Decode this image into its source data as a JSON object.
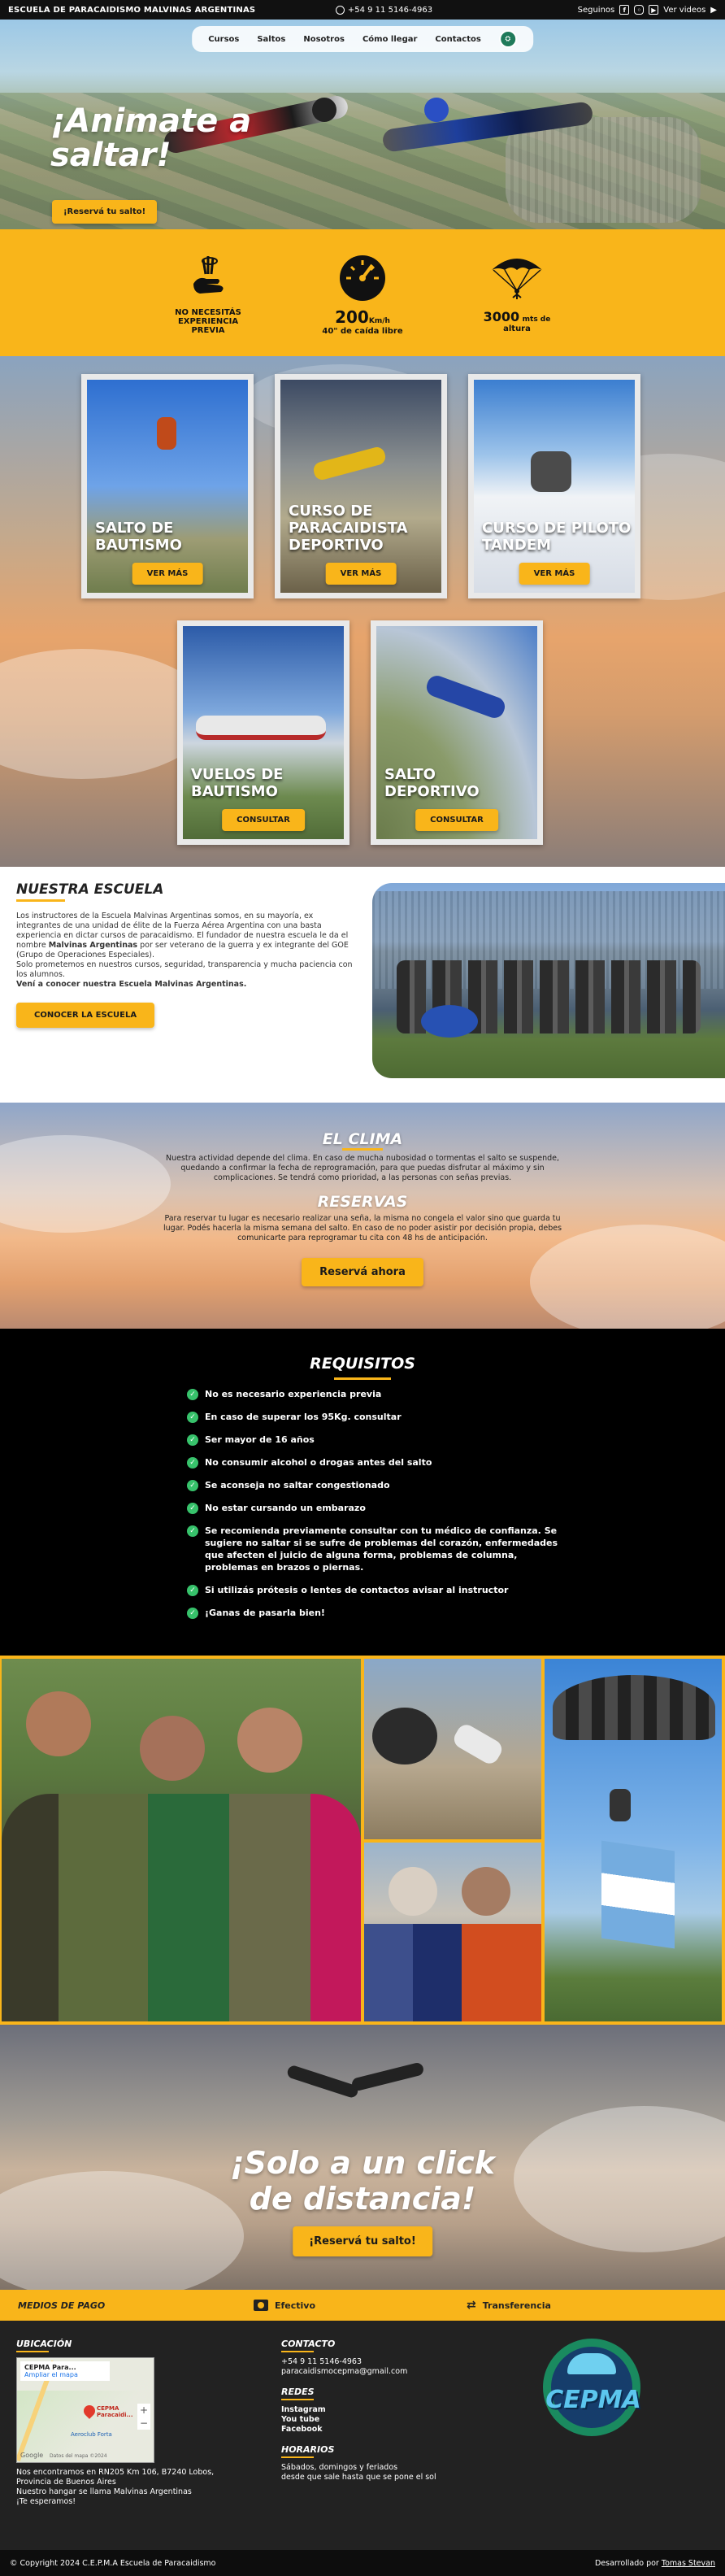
{
  "topbar": {
    "brand": "ESCUELA DE PARACAIDISMO MALVINAS ARGENTINAS",
    "phone": "+54 9 11 5146-4963",
    "follow": "Seguinos",
    "videos": "Ver videos"
  },
  "nav": [
    "Cursos",
    "Saltos",
    "Nosotros",
    "Cómo llegar",
    "Contactos"
  ],
  "hero": {
    "title_line1": "¡Animate a",
    "title_line2": "saltar!",
    "cta": "¡Reservá tu salto!"
  },
  "stats": [
    {
      "icon": "hand-icon",
      "lines": [
        "NO NECESITÁS",
        "EXPERIENCIA",
        "PREVIA"
      ]
    },
    {
      "icon": "speedometer-icon",
      "big": "200",
      "unit": "Km/h",
      "sub": "40\" de caída libre"
    },
    {
      "icon": "parachute-icon",
      "big": "3000",
      "unit": "mts de",
      "sub": "altura"
    }
  ],
  "courses": [
    {
      "title": "SALTO DE BAUTISMO",
      "button": "VER MÁS"
    },
    {
      "title": "CURSO DE PARACAIDISTA DEPORTIVO",
      "button": "VER MÁS"
    },
    {
      "title": "CURSO DE PILOTO TANDEM",
      "button": "VER MÁS"
    },
    {
      "title": "VUELOS DE BAUTISMO",
      "button": "CONSULTAR"
    },
    {
      "title": "SALTO DEPORTIVO",
      "button": "CONSULTAR"
    }
  ],
  "school": {
    "title": "NUESTRA ESCUELA",
    "p1_before": "Los instructores de la Escuela Malvinas Argentinas somos, en su mayoría, ex integrantes de una unidad de élite de la Fuerza Aérea Argentina con una basta experiencia en dictar cursos de paracaidismo. El fundador de nuestra escuela le da el nombre ",
    "p1_bold": "Malvinas Argentinas",
    "p1_after": " por ser veterano de la guerra y ex integrante del GOE (Grupo de Operaciones Especiales).",
    "p2": "Solo prometemos en nuestros cursos, seguridad, transparencia y mucha paciencia con los alumnos.",
    "p3": "Vení a conocer nuestra Escuela Malvinas Argentinas.",
    "button": "CONOCER LA ESCUELA"
  },
  "clima": {
    "title": "EL CLIMA",
    "text": "Nuestra actividad depende del clima. En caso de mucha nubosidad o tormentas el salto se suspende, quedando a confirmar la fecha de reprogramación, para que puedas disfrutar al máximo y sin complicaciones. Se tendrá como prioridad, a las personas con señas previas.",
    "title2": "RESERVAS",
    "text2": "Para reservar tu lugar es necesario realizar una seña, la misma no congela el valor sino que guarda tu lugar. Podés hacerla la misma semana del salto. En caso de no poder asistir por decisión propia, debes comunicarte para reprogramar tu cita con 48 hs de anticipación.",
    "button": "Reservá ahora"
  },
  "requisitos": {
    "title": "REQUISITOS",
    "items": [
      "No es necesario experiencia previa",
      "En caso de superar los 95Kg. consultar",
      "Ser mayor de 16 años",
      "No consumir alcohol o drogas antes del salto",
      "Se aconseja no saltar congestionado",
      "No estar cursando un embarazo",
      "Se recomienda previamente consultar con tu médico de confianza. Se sugiere no saltar si se sufre de problemas del corazón, enfermedades que afecten el juicio de alguna forma, problemas de columna, problemas en brazos o piernas.",
      "Si utilizás prótesis o lentes de contactos avisar al instructor",
      "¡Ganas de pasarla bien!"
    ]
  },
  "cta": {
    "line1": "¡Solo a un click",
    "line2": "de distancia!",
    "button": "¡Reservá tu salto!"
  },
  "pago": {
    "label": "MEDIOS DE PAGO",
    "efectivo": "Efectivo",
    "transferencia": "Transferencia"
  },
  "footer": {
    "ubicacion": {
      "title": "UBICACIÓN",
      "map_title": "CEPMA Para...",
      "map_link": "Ampliar el mapa",
      "map_pin": "CEPMA Paracaidi...",
      "map_place": "Aeroclub Forta",
      "map_brand": "Google",
      "map_copy": "Datos del mapa ©2024",
      "lines": [
        "Nos encontramos en RN205 Km 106, B7240 Lobos,",
        "Provincia de Buenos Aires",
        "Nuestro hangar se llama Malvinas Argentinas",
        "¡Te esperamos!"
      ]
    },
    "contacto": {
      "title": "CONTACTO",
      "phone": "+54 9 11 5146-4963",
      "email": "paracaidismocepma@gmail.com"
    },
    "redes": {
      "title": "REDES",
      "items": [
        "Instagram",
        "You tube",
        "Facebook"
      ]
    },
    "horarios": {
      "title": "HORARIOS",
      "lines": [
        "Sábados, domingos y feriados",
        "desde que sale hasta que se pone el sol"
      ]
    },
    "logo_text": "CEPMA"
  },
  "copyright": {
    "text": "© Copyright 2024 C.E.P.M.A Escuela de Paracaidismo",
    "dev_label": "Desarrollado por",
    "dev_name": "Tomas Stevan"
  },
  "colors": {
    "accent": "#f9b51a",
    "dark": "#111111",
    "check": "#37c26b"
  }
}
